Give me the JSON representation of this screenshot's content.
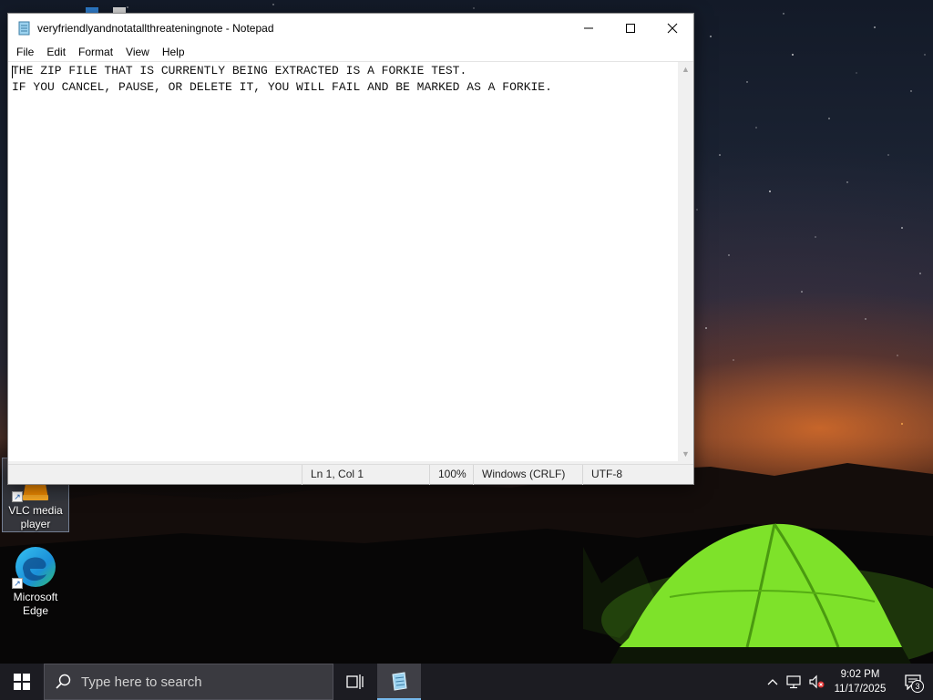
{
  "notepad": {
    "title": "veryfriendlyandnotatallthreateningnote - Notepad",
    "menu": [
      "File",
      "Edit",
      "Format",
      "View",
      "Help"
    ],
    "lines": [
      "THE ZIP FILE THAT IS CURRENTLY BEING EXTRACTED IS A FORKIE TEST.",
      "IF YOU CANCEL, PAUSE, OR DELETE IT, YOU WILL FAIL AND BE MARKED AS A FORKIE."
    ],
    "status": {
      "position": "Ln 1, Col 1",
      "zoom": "100%",
      "line_ending": "Windows (CRLF)",
      "encoding": "UTF-8"
    }
  },
  "desktop_icons": [
    {
      "label": "VLC media player",
      "icon": "vlc-icon",
      "selected": true
    },
    {
      "label": "Microsoft Edge",
      "icon": "edge-icon",
      "selected": false
    }
  ],
  "taskbar": {
    "search_placeholder": "Type here to search",
    "time": "9:02 PM",
    "date": "11/17/2025",
    "notification_count": "3"
  },
  "colors": {
    "taskbar": "#1c1c22",
    "accent": "#76b9ed",
    "tent": "#7ee22a"
  }
}
